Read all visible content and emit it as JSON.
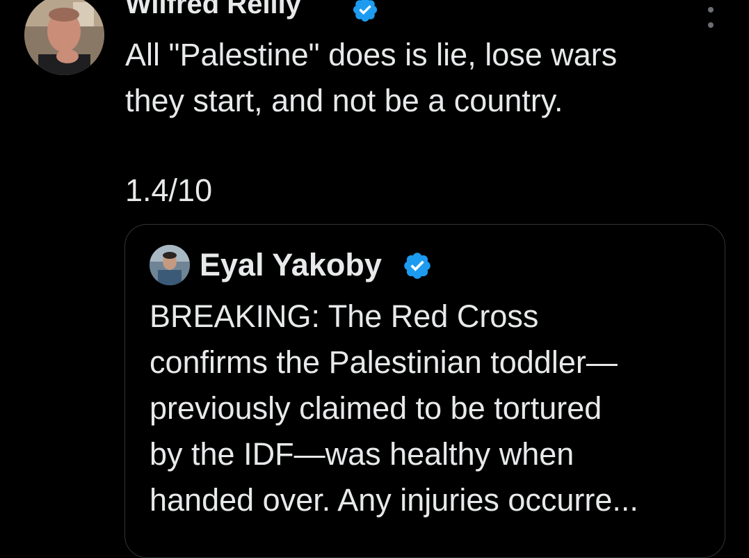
{
  "tweet": {
    "author_name": "Wilfred Reilly",
    "text": "All \"Palestine\" does is lie, lose wars\nthey start, and not be a country.",
    "rating": "1.4/10",
    "more_icon": "more-vertical-icon"
  },
  "quote": {
    "author_name": "Eyal Yakoby",
    "text": "BREAKING: The Red Cross\nconfirms the Palestinian toddler—\npreviously claimed to be tortured\nby the IDF—was healthy when\nhanded over. Any injuries occurre..."
  },
  "colors": {
    "background": "#000000",
    "text": "#e7e9ea",
    "verified_badge": "#1d9bf0",
    "card_border": "#2f3336",
    "icon_muted": "#6b6f73"
  }
}
